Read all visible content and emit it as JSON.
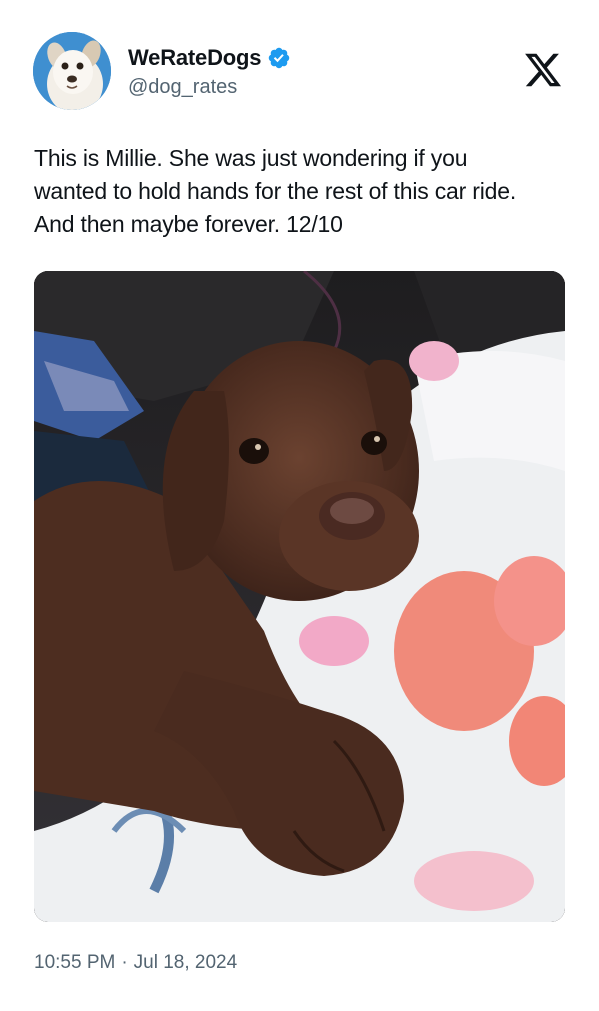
{
  "author": {
    "display_name": "WeRateDogs",
    "handle": "@dog_rates",
    "verified": true,
    "avatar_icon": "dog-avatar-icon",
    "verified_icon": "verified-badge-icon"
  },
  "brand": {
    "logo_icon": "x-logo-icon"
  },
  "tweet": {
    "text": "This is Millie. She was just wondering if you\nwanted to hold hands for the rest of this car ride.\nAnd then maybe forever. 12/10"
  },
  "media": {
    "kind": "photo"
  },
  "meta": {
    "time": "10:55 PM",
    "separator": "·",
    "date": "Jul 18, 2024"
  },
  "colors": {
    "text": "#0f1419",
    "secondary": "#536471",
    "verified": "#1d9bf0",
    "background": "#ffffff"
  }
}
